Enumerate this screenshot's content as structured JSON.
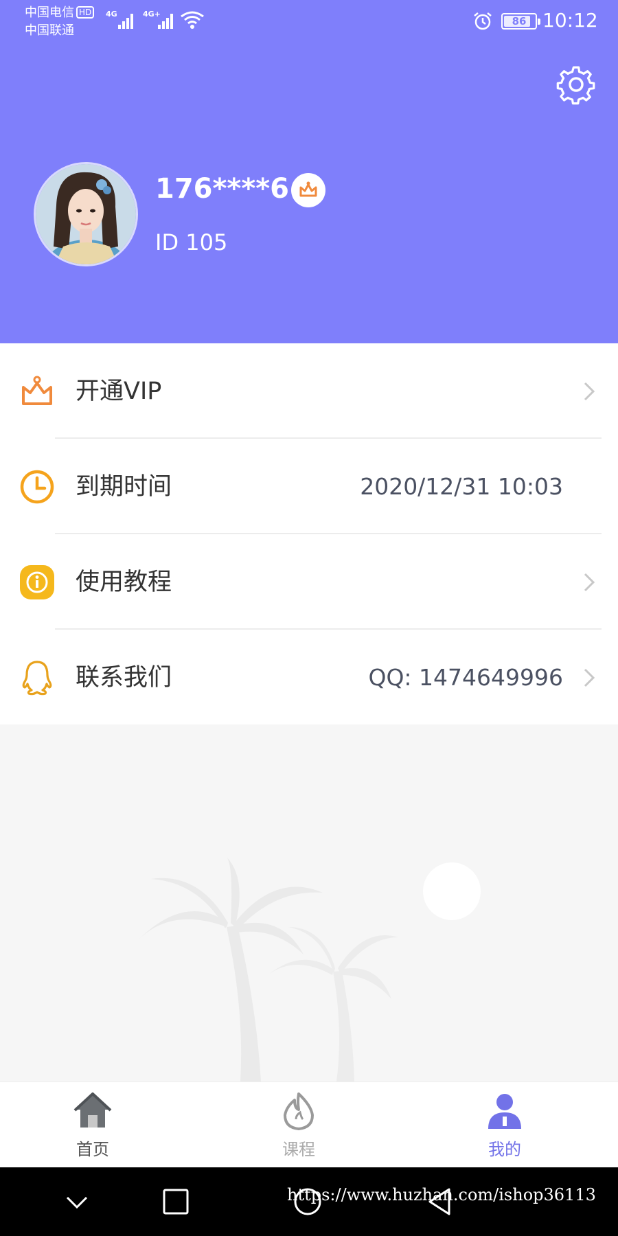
{
  "status_bar": {
    "carrier_1": "中国电信",
    "hd_badge": "HD",
    "carrier_2": "中国联通",
    "network_1": "4G",
    "network_2": "4G+",
    "battery": "86",
    "time": "10:12"
  },
  "profile": {
    "username": "176****6",
    "user_id": "ID 105"
  },
  "menu": {
    "items": [
      {
        "label": "开通VIP",
        "value": "",
        "icon": "crown-icon",
        "has_chevron": true
      },
      {
        "label": "到期时间",
        "value": "2020/12/31 10:03",
        "icon": "clock-icon",
        "has_chevron": false
      },
      {
        "label": "使用教程",
        "value": "",
        "icon": "info-icon",
        "has_chevron": true
      },
      {
        "label": "联系我们",
        "value": "QQ: 1474649996",
        "icon": "qq-icon",
        "has_chevron": true
      }
    ]
  },
  "tabbar": {
    "tabs": [
      {
        "label": "首页",
        "icon": "home-icon",
        "active": false
      },
      {
        "label": "课程",
        "icon": "flame-icon",
        "active": false
      },
      {
        "label": "我的",
        "icon": "user-icon",
        "active": true
      }
    ]
  },
  "watermark": "https://www.huzhan.com/ishop36113",
  "colors": {
    "header_bg": "#7f7ffb",
    "accent_orange": "#f08a3c",
    "accent_yellow": "#f5b81c",
    "active_tab": "#7272e8",
    "inactive_tab": "#aaaaaa"
  }
}
